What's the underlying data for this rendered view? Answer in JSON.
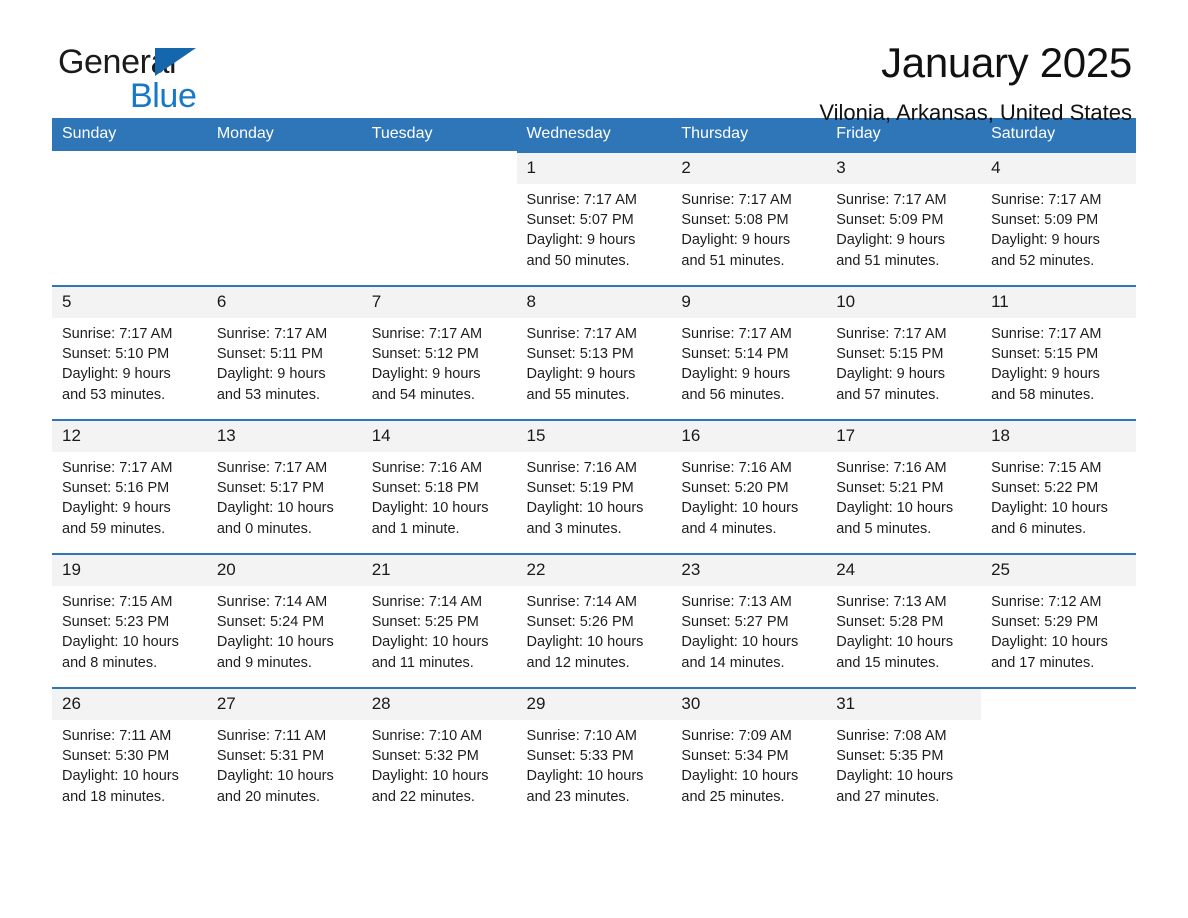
{
  "brand": {
    "name_part1": "General",
    "name_part2": "Blue",
    "triangle_color": "#1567ad",
    "blue_text_color": "#1878c8"
  },
  "header": {
    "title": "January 2025",
    "location": "Vilonia, Arkansas, United States"
  },
  "theme": {
    "header_row_bg": "#2e76b8",
    "header_row_text": "#ffffff",
    "daynum_bg": "#f3f3f3",
    "row_divider": "#2e76b8",
    "page_bg": "#ffffff"
  },
  "calendar": {
    "weekday_headers": [
      "Sunday",
      "Monday",
      "Tuesday",
      "Wednesday",
      "Thursday",
      "Friday",
      "Saturday"
    ],
    "weeks": [
      [
        {
          "day": "",
          "sunrise": "",
          "sunset": "",
          "daylight": "",
          "blank": true
        },
        {
          "day": "",
          "sunrise": "",
          "sunset": "",
          "daylight": "",
          "blank": true
        },
        {
          "day": "",
          "sunrise": "",
          "sunset": "",
          "daylight": "",
          "blank": true
        },
        {
          "day": "1",
          "sunrise": "Sunrise: 7:17 AM",
          "sunset": "Sunset: 5:07 PM",
          "daylight": "Daylight: 9 hours and 50 minutes."
        },
        {
          "day": "2",
          "sunrise": "Sunrise: 7:17 AM",
          "sunset": "Sunset: 5:08 PM",
          "daylight": "Daylight: 9 hours and 51 minutes."
        },
        {
          "day": "3",
          "sunrise": "Sunrise: 7:17 AM",
          "sunset": "Sunset: 5:09 PM",
          "daylight": "Daylight: 9 hours and 51 minutes."
        },
        {
          "day": "4",
          "sunrise": "Sunrise: 7:17 AM",
          "sunset": "Sunset: 5:09 PM",
          "daylight": "Daylight: 9 hours and 52 minutes."
        }
      ],
      [
        {
          "day": "5",
          "sunrise": "Sunrise: 7:17 AM",
          "sunset": "Sunset: 5:10 PM",
          "daylight": "Daylight: 9 hours and 53 minutes."
        },
        {
          "day": "6",
          "sunrise": "Sunrise: 7:17 AM",
          "sunset": "Sunset: 5:11 PM",
          "daylight": "Daylight: 9 hours and 53 minutes."
        },
        {
          "day": "7",
          "sunrise": "Sunrise: 7:17 AM",
          "sunset": "Sunset: 5:12 PM",
          "daylight": "Daylight: 9 hours and 54 minutes."
        },
        {
          "day": "8",
          "sunrise": "Sunrise: 7:17 AM",
          "sunset": "Sunset: 5:13 PM",
          "daylight": "Daylight: 9 hours and 55 minutes."
        },
        {
          "day": "9",
          "sunrise": "Sunrise: 7:17 AM",
          "sunset": "Sunset: 5:14 PM",
          "daylight": "Daylight: 9 hours and 56 minutes."
        },
        {
          "day": "10",
          "sunrise": "Sunrise: 7:17 AM",
          "sunset": "Sunset: 5:15 PM",
          "daylight": "Daylight: 9 hours and 57 minutes."
        },
        {
          "day": "11",
          "sunrise": "Sunrise: 7:17 AM",
          "sunset": "Sunset: 5:15 PM",
          "daylight": "Daylight: 9 hours and 58 minutes."
        }
      ],
      [
        {
          "day": "12",
          "sunrise": "Sunrise: 7:17 AM",
          "sunset": "Sunset: 5:16 PM",
          "daylight": "Daylight: 9 hours and 59 minutes."
        },
        {
          "day": "13",
          "sunrise": "Sunrise: 7:17 AM",
          "sunset": "Sunset: 5:17 PM",
          "daylight": "Daylight: 10 hours and 0 minutes."
        },
        {
          "day": "14",
          "sunrise": "Sunrise: 7:16 AM",
          "sunset": "Sunset: 5:18 PM",
          "daylight": "Daylight: 10 hours and 1 minute."
        },
        {
          "day": "15",
          "sunrise": "Sunrise: 7:16 AM",
          "sunset": "Sunset: 5:19 PM",
          "daylight": "Daylight: 10 hours and 3 minutes."
        },
        {
          "day": "16",
          "sunrise": "Sunrise: 7:16 AM",
          "sunset": "Sunset: 5:20 PM",
          "daylight": "Daylight: 10 hours and 4 minutes."
        },
        {
          "day": "17",
          "sunrise": "Sunrise: 7:16 AM",
          "sunset": "Sunset: 5:21 PM",
          "daylight": "Daylight: 10 hours and 5 minutes."
        },
        {
          "day": "18",
          "sunrise": "Sunrise: 7:15 AM",
          "sunset": "Sunset: 5:22 PM",
          "daylight": "Daylight: 10 hours and 6 minutes."
        }
      ],
      [
        {
          "day": "19",
          "sunrise": "Sunrise: 7:15 AM",
          "sunset": "Sunset: 5:23 PM",
          "daylight": "Daylight: 10 hours and 8 minutes."
        },
        {
          "day": "20",
          "sunrise": "Sunrise: 7:14 AM",
          "sunset": "Sunset: 5:24 PM",
          "daylight": "Daylight: 10 hours and 9 minutes."
        },
        {
          "day": "21",
          "sunrise": "Sunrise: 7:14 AM",
          "sunset": "Sunset: 5:25 PM",
          "daylight": "Daylight: 10 hours and 11 minutes."
        },
        {
          "day": "22",
          "sunrise": "Sunrise: 7:14 AM",
          "sunset": "Sunset: 5:26 PM",
          "daylight": "Daylight: 10 hours and 12 minutes."
        },
        {
          "day": "23",
          "sunrise": "Sunrise: 7:13 AM",
          "sunset": "Sunset: 5:27 PM",
          "daylight": "Daylight: 10 hours and 14 minutes."
        },
        {
          "day": "24",
          "sunrise": "Sunrise: 7:13 AM",
          "sunset": "Sunset: 5:28 PM",
          "daylight": "Daylight: 10 hours and 15 minutes."
        },
        {
          "day": "25",
          "sunrise": "Sunrise: 7:12 AM",
          "sunset": "Sunset: 5:29 PM",
          "daylight": "Daylight: 10 hours and 17 minutes."
        }
      ],
      [
        {
          "day": "26",
          "sunrise": "Sunrise: 7:11 AM",
          "sunset": "Sunset: 5:30 PM",
          "daylight": "Daylight: 10 hours and 18 minutes."
        },
        {
          "day": "27",
          "sunrise": "Sunrise: 7:11 AM",
          "sunset": "Sunset: 5:31 PM",
          "daylight": "Daylight: 10 hours and 20 minutes."
        },
        {
          "day": "28",
          "sunrise": "Sunrise: 7:10 AM",
          "sunset": "Sunset: 5:32 PM",
          "daylight": "Daylight: 10 hours and 22 minutes."
        },
        {
          "day": "29",
          "sunrise": "Sunrise: 7:10 AM",
          "sunset": "Sunset: 5:33 PM",
          "daylight": "Daylight: 10 hours and 23 minutes."
        },
        {
          "day": "30",
          "sunrise": "Sunrise: 7:09 AM",
          "sunset": "Sunset: 5:34 PM",
          "daylight": "Daylight: 10 hours and 25 minutes."
        },
        {
          "day": "31",
          "sunrise": "Sunrise: 7:08 AM",
          "sunset": "Sunset: 5:35 PM",
          "daylight": "Daylight: 10 hours and 27 minutes."
        },
        {
          "day": "",
          "sunrise": "",
          "sunset": "",
          "daylight": "",
          "blank": true
        }
      ]
    ]
  }
}
